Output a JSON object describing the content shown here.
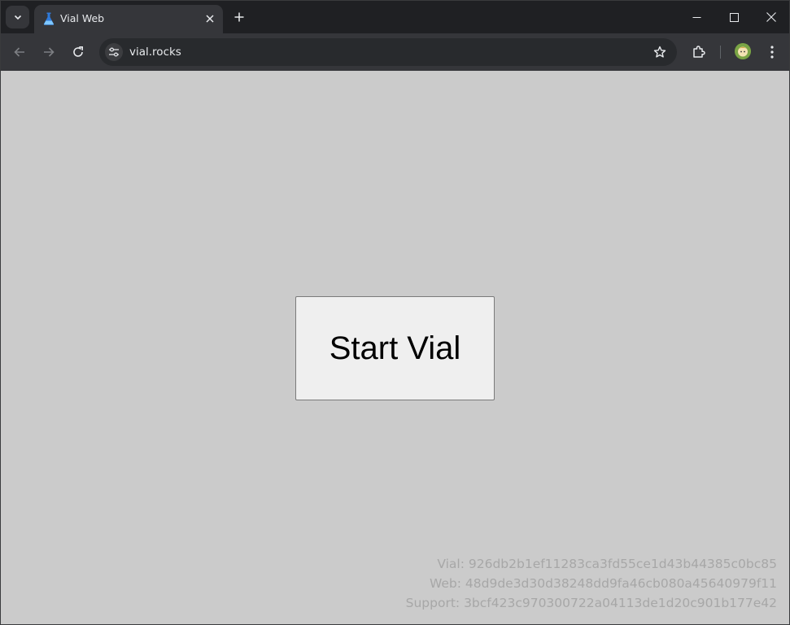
{
  "browser": {
    "tab": {
      "title": "Vial Web"
    },
    "omnibox": {
      "url": "vial.rocks"
    }
  },
  "page": {
    "start_button_label": "Start Vial",
    "versions": {
      "vial": "Vial: 926db2b1ef11283ca3fd55ce1d43b44385c0bc85",
      "web": "Web: 48d9de3d30d38248dd9fa46cb080a45640979f11",
      "support": "Support: 3bcf423c970300722a04113de1d20c901b177e42"
    }
  },
  "colors": {
    "page_background": "#cbcbcb",
    "button_background": "#efefef",
    "version_text": "#a7a7a7",
    "browser_chrome": "#35363a"
  },
  "icons": {
    "tab_search": "chevron-down-icon",
    "favicon": "flask-icon",
    "tab_close": "close-icon",
    "new_tab": "plus-icon",
    "back": "arrow-left-icon",
    "forward": "arrow-right-icon",
    "reload": "reload-icon",
    "site_info": "tune-icon",
    "bookmark": "star-icon",
    "extensions": "puzzle-icon",
    "profile": "avatar",
    "menu": "kebab-menu-icon"
  }
}
